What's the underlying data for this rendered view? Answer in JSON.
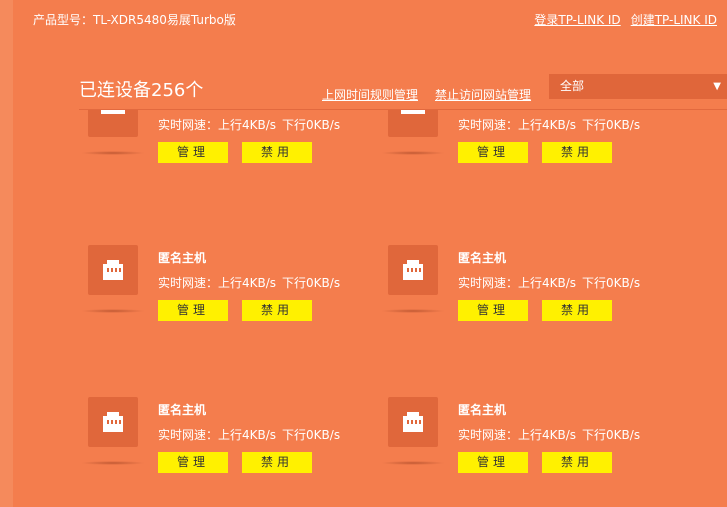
{
  "header": {
    "model_label": "产品型号：TL-XDR5480易展Turbo版",
    "login_link": "登录TP-LINK ID",
    "create_link": "创建TP-LINK ID"
  },
  "devices_section": {
    "title": "已连设备256个",
    "schedule_link": "上网时间规则管理",
    "block_sites_link": "禁止访问网站管理",
    "filter": {
      "selected": "全部",
      "arrow": "▼"
    }
  },
  "colors": {
    "background": "#f47d4d",
    "panel": "#e0663a",
    "button": "#fff100"
  },
  "devices": [
    {
      "name": "",
      "speed_up": "实时网速：上行4KB/s",
      "speed_down": "下行0KB/s",
      "manage_label": "管理",
      "block_label": "禁用",
      "icon": "monitor-icon"
    },
    {
      "name": "",
      "speed_up": "实时网速：上行4KB/s",
      "speed_down": "下行0KB/s",
      "manage_label": "管理",
      "block_label": "禁用",
      "icon": "monitor-icon"
    },
    {
      "name": "匿名主机",
      "speed_up": "实时网速：上行4KB/s",
      "speed_down": "下行0KB/s",
      "manage_label": "管理",
      "block_label": "禁用",
      "icon": "ethernet-port-icon"
    },
    {
      "name": "匿名主机",
      "speed_up": "实时网速：上行4KB/s",
      "speed_down": "下行0KB/s",
      "manage_label": "管理",
      "block_label": "禁用",
      "icon": "ethernet-port-icon"
    },
    {
      "name": "匿名主机",
      "speed_up": "实时网速：上行4KB/s",
      "speed_down": "下行0KB/s",
      "manage_label": "管理",
      "block_label": "禁用",
      "icon": "ethernet-port-icon"
    },
    {
      "name": "匿名主机",
      "speed_up": "实时网速：上行4KB/s",
      "speed_down": "下行0KB/s",
      "manage_label": "管理",
      "block_label": "禁用",
      "icon": "ethernet-port-icon"
    }
  ]
}
